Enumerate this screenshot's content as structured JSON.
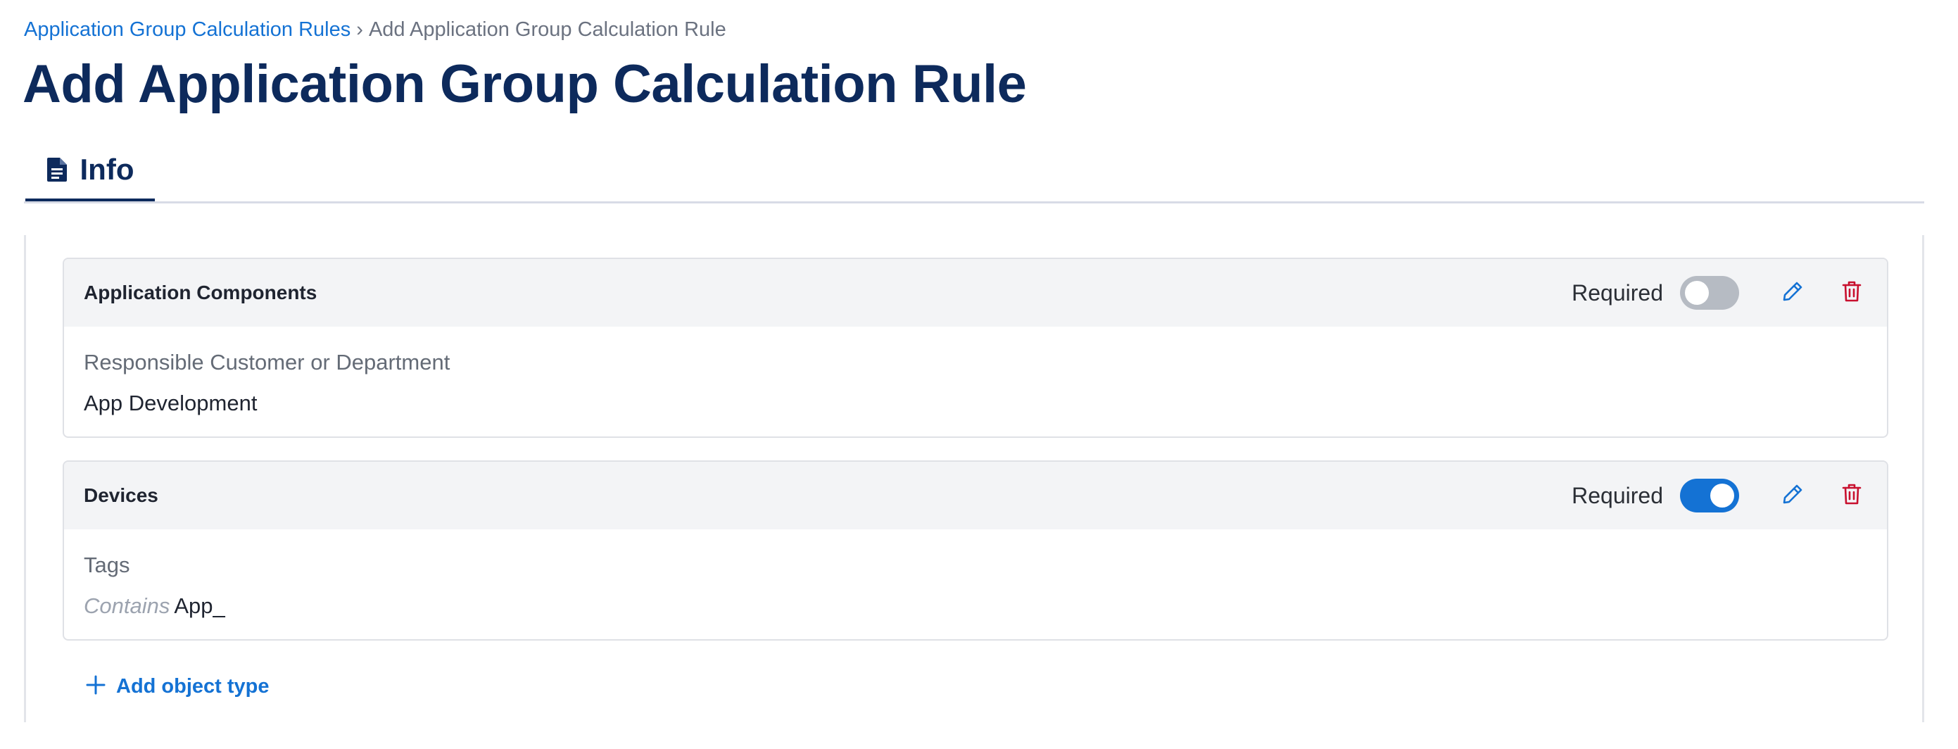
{
  "breadcrumb": {
    "parent": "Application Group Calculation Rules",
    "separator": "›",
    "current": "Add Application Group Calculation Rule"
  },
  "page_title": "Add Application Group Calculation Rule",
  "tabs": [
    {
      "label": "Info",
      "icon": "document-icon",
      "active": true
    }
  ],
  "rules": [
    {
      "title": "Application Components",
      "required_label": "Required",
      "required": false,
      "field_label": "Responsible Customer or Department",
      "field_operator": "",
      "field_value": "App Development"
    },
    {
      "title": "Devices",
      "required_label": "Required",
      "required": true,
      "field_label": "Tags",
      "field_operator": "Contains",
      "field_value": "App_"
    }
  ],
  "add_object_type": {
    "label": "Add object type",
    "icon": "plus-icon"
  },
  "colors": {
    "accent": "#1472d4",
    "title": "#0d2a5c",
    "delete": "#c8102e",
    "toggle_off": "#b6bbc3"
  }
}
